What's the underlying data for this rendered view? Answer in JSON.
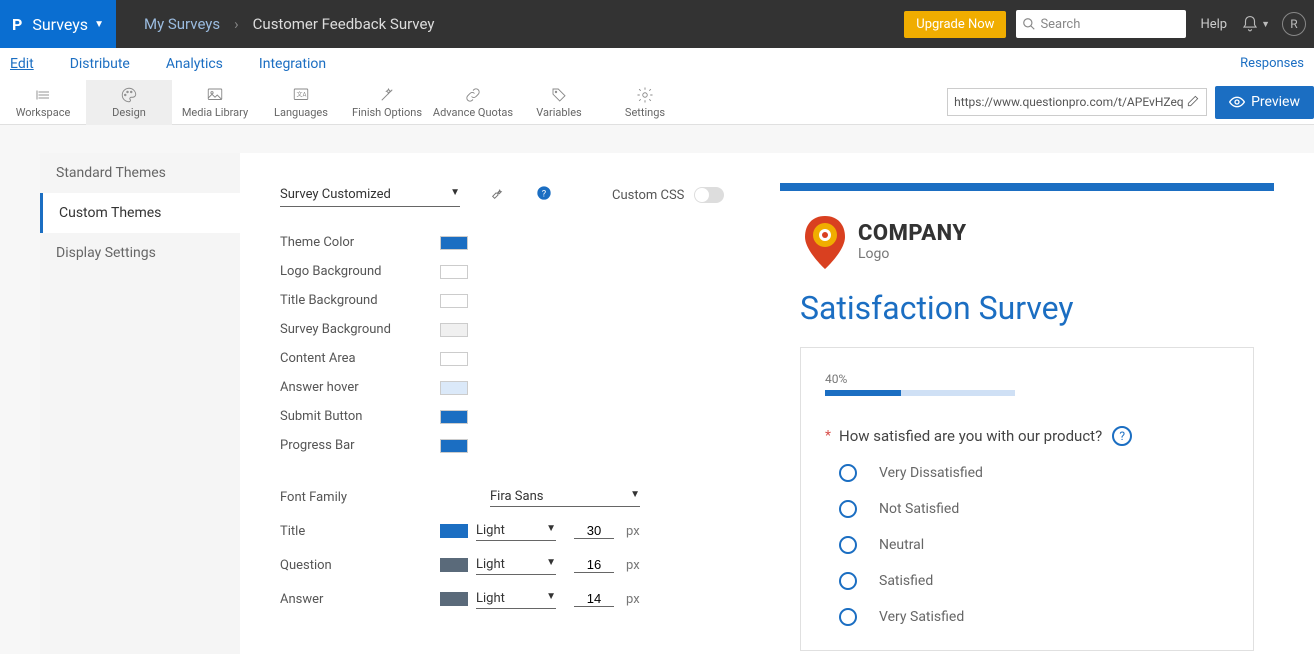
{
  "topbar": {
    "brand": "Surveys",
    "breadcrumb_root": "My Surveys",
    "breadcrumb_current": "Customer Feedback Survey",
    "upgrade": "Upgrade Now",
    "search_placeholder": "Search",
    "help": "Help",
    "avatar_initial": "R"
  },
  "subnav": {
    "tabs": [
      "Edit",
      "Distribute",
      "Analytics",
      "Integration"
    ],
    "right": "Responses"
  },
  "toolbar": {
    "items": [
      "Workspace",
      "Design",
      "Media Library",
      "Languages",
      "Finish Options",
      "Advance Quotas",
      "Variables",
      "Settings"
    ],
    "url": "https://www.questionpro.com/t/APEvHZeq",
    "preview": "Preview"
  },
  "sidebar": {
    "items": [
      "Standard Themes",
      "Custom Themes",
      "Display Settings"
    ]
  },
  "themeSelect": "Survey Customized",
  "customCssLabel": "Custom CSS",
  "colors": [
    {
      "label": "Theme Color",
      "value": "#1b6ec2"
    },
    {
      "label": "Logo Background",
      "value": "#ffffff"
    },
    {
      "label": "Title Background",
      "value": "#ffffff"
    },
    {
      "label": "Survey Background",
      "value": "#f0f0f0"
    },
    {
      "label": "Content Area",
      "value": "#ffffff"
    },
    {
      "label": "Answer hover",
      "value": "#dbe9f9"
    },
    {
      "label": "Submit Button",
      "value": "#1b6ec2"
    },
    {
      "label": "Progress Bar",
      "value": "#1b6ec2"
    }
  ],
  "font": {
    "familyLabel": "Font Family",
    "family": "Fira Sans",
    "rows": [
      {
        "label": "Title",
        "swatch": "#1b6ec2",
        "weight": "Light",
        "size": "30",
        "unit": "px"
      },
      {
        "label": "Question",
        "swatch": "#5a6a7a",
        "weight": "Light",
        "size": "16",
        "unit": "px"
      },
      {
        "label": "Answer",
        "swatch": "#5a6a7a",
        "weight": "Light",
        "size": "14",
        "unit": "px"
      }
    ]
  },
  "preview": {
    "company": "COMPANY",
    "companySub": "Logo",
    "title": "Satisfaction Survey",
    "progress": "40%",
    "progressPct": 40,
    "question": "How satisfied are you with our product?",
    "options": [
      "Very Dissatisfied",
      "Not Satisfied",
      "Neutral",
      "Satisfied",
      "Very Satisfied"
    ]
  }
}
